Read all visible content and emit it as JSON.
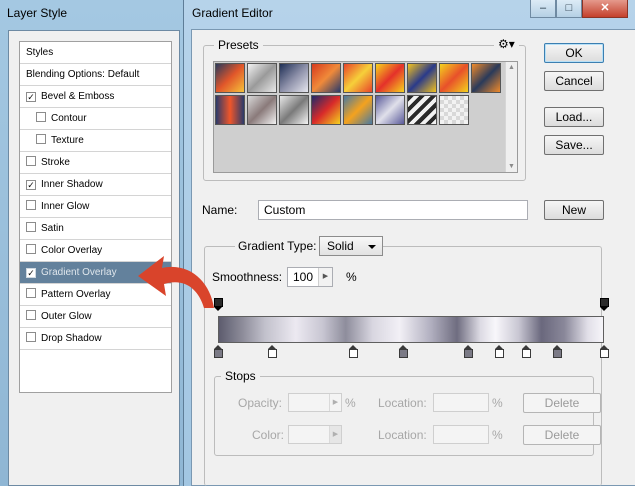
{
  "layer_style": {
    "title": "Layer Style",
    "items": [
      {
        "label": "Styles",
        "checkbox": false,
        "indent": false,
        "checked": false,
        "selected": false
      },
      {
        "label": "Blending Options: Default",
        "checkbox": false,
        "indent": false,
        "checked": false,
        "selected": false
      },
      {
        "label": "Bevel & Emboss",
        "checkbox": true,
        "indent": false,
        "checked": true,
        "selected": false
      },
      {
        "label": "Contour",
        "checkbox": true,
        "indent": true,
        "checked": false,
        "selected": false
      },
      {
        "label": "Texture",
        "checkbox": true,
        "indent": true,
        "checked": false,
        "selected": false
      },
      {
        "label": "Stroke",
        "checkbox": true,
        "indent": false,
        "checked": false,
        "selected": false
      },
      {
        "label": "Inner Shadow",
        "checkbox": true,
        "indent": false,
        "checked": true,
        "selected": false
      },
      {
        "label": "Inner Glow",
        "checkbox": true,
        "indent": false,
        "checked": false,
        "selected": false
      },
      {
        "label": "Satin",
        "checkbox": true,
        "indent": false,
        "checked": false,
        "selected": false
      },
      {
        "label": "Color Overlay",
        "checkbox": true,
        "indent": false,
        "checked": false,
        "selected": false
      },
      {
        "label": "Gradient Overlay",
        "checkbox": true,
        "indent": false,
        "checked": true,
        "selected": true
      },
      {
        "label": "Pattern Overlay",
        "checkbox": true,
        "indent": false,
        "checked": false,
        "selected": false
      },
      {
        "label": "Outer Glow",
        "checkbox": true,
        "indent": false,
        "checked": false,
        "selected": false
      },
      {
        "label": "Drop Shadow",
        "checkbox": true,
        "indent": false,
        "checked": false,
        "selected": false
      }
    ]
  },
  "gradient_editor": {
    "title": "Gradient Editor",
    "caption_buttons": {
      "minimize": "–",
      "maximize": "□",
      "close": "✕"
    },
    "presets": {
      "label": "Presets",
      "menu_icon": "gear-icon",
      "scroll_up": "▲",
      "scroll_down": "▼",
      "swatches": [
        {
          "colors": [
            "#2a3a5c",
            "#e0562a",
            "#f6c23a"
          ],
          "style": "diagonal"
        },
        {
          "colors": [
            "#f2f2f2",
            "#9a9a9a",
            "#e8e8e8"
          ],
          "style": "diagonal"
        },
        {
          "colors": [
            "#1f2f55",
            "#8c8fa8",
            "#e6e6ee"
          ],
          "style": "diagonal"
        },
        {
          "colors": [
            "#d63a1e",
            "#f08a3a",
            "#2a3a6a"
          ],
          "style": "diagonal"
        },
        {
          "colors": [
            "#e8442a",
            "#f6d03a",
            "#e8442a"
          ],
          "style": "diagonal"
        },
        {
          "colors": [
            "#f6d21e",
            "#e4312a",
            "#f6d21e"
          ],
          "style": "diagonal"
        },
        {
          "colors": [
            "#f2c21e",
            "#2a3a8a",
            "#f2c21e"
          ],
          "style": "diagonal"
        },
        {
          "colors": [
            "#f4d21e",
            "#e8502a",
            "#f4d21e"
          ],
          "style": "diagonal"
        },
        {
          "colors": [
            "#f08a2a",
            "#2a3a5a",
            "#f08a2a"
          ],
          "style": "diagonal"
        },
        {
          "colors": [
            "#2a3a6a",
            "#f0562a",
            "#2a3a6a"
          ],
          "style": "horizontal"
        },
        {
          "colors": [
            "#d8d8d8",
            "#8a7a7a",
            "#f2f2f2"
          ],
          "style": "diagonal"
        },
        {
          "colors": [
            "#e8e8e8",
            "#7a7a7a",
            "#f4f4f4"
          ],
          "style": "diagonal"
        },
        {
          "colors": [
            "#1e2a6a",
            "#d82a2a",
            "#f4d21e"
          ],
          "style": "diagonal"
        },
        {
          "colors": [
            "#4a7aa2",
            "#f4a21e",
            "#4a7aa2"
          ],
          "style": "diagonal"
        },
        {
          "colors": [
            "#5a5a9a",
            "#e0e0ea",
            "#5a5a9a"
          ],
          "style": "diagonal"
        },
        {
          "colors": [
            "#2a2a2a",
            "#f2f2f2",
            "#2a2a2a"
          ],
          "style": "stripes"
        },
        {
          "colors": [
            "#d8d8d8",
            "#f2f2f2"
          ],
          "style": "checker"
        }
      ]
    },
    "buttons": {
      "ok": "OK",
      "cancel": "Cancel",
      "load": "Load...",
      "save": "Save...",
      "new": "New",
      "delete_opacity": "Delete",
      "delete_color": "Delete"
    },
    "name": {
      "label": "Name:",
      "value": "Custom"
    },
    "gradient_type": {
      "label": "Gradient Type:",
      "value": "Solid"
    },
    "smoothness": {
      "label": "Smoothness:",
      "value": "100",
      "unit": "%"
    },
    "gradient_bar": {
      "opacity_stops": [
        0,
        100
      ],
      "color_stops": [
        0,
        14,
        35,
        48,
        65,
        73,
        80,
        88,
        100
      ]
    },
    "stops": {
      "label": "Stops",
      "opacity_label": "Opacity:",
      "opacity_unit": "%",
      "location_label": "Location:",
      "location_unit": "%",
      "color_label": "Color:"
    }
  },
  "colors": {
    "window_frame": "#a4c8e2",
    "selected_row": "#63819c",
    "red_arrow": "#d9442b"
  }
}
